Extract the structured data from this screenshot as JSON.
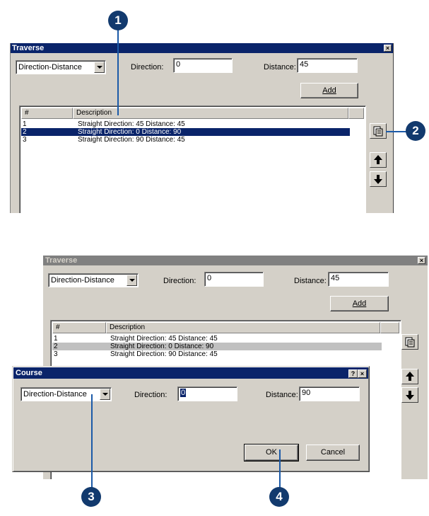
{
  "window1": {
    "title": "Traverse",
    "mode": "Direction-Distance",
    "direction_label": "Direction:",
    "direction_value": "0",
    "distance_label": "Distance:",
    "distance_value": "45",
    "add_label": "Add",
    "columns": [
      "#",
      "Description"
    ],
    "rows": [
      {
        "num": "1",
        "desc": "Straight  Direction: 45  Distance: 45"
      },
      {
        "num": "2",
        "desc": "Straight  Direction: 0  Distance: 90"
      },
      {
        "num": "3",
        "desc": "Straight  Direction: 90  Distance: 45"
      }
    ]
  },
  "window2": {
    "title": "Traverse",
    "mode": "Direction-Distance",
    "direction_label": "Direction:",
    "direction_value": "0",
    "distance_label": "Distance:",
    "distance_value": "45",
    "add_label": "Add",
    "columns": [
      "#",
      "Description"
    ],
    "rows": [
      {
        "num": "1",
        "desc": "Straight  Direction: 45  Distance: 45"
      },
      {
        "num": "2",
        "desc": "Straight  Direction: 0  Distance: 90"
      },
      {
        "num": "3",
        "desc": "Straight  Direction: 90  Distance: 45"
      }
    ]
  },
  "course": {
    "title": "Course",
    "help_label": "?",
    "mode": "Direction-Distance",
    "direction_label": "Direction:",
    "direction_value": "0",
    "distance_label": "Distance:",
    "distance_value": "90",
    "ok_label": "OK",
    "cancel_label": "Cancel"
  },
  "callouts": [
    "1",
    "2",
    "3",
    "4"
  ],
  "icons": {
    "properties": "properties-icon",
    "up": "arrow-up-icon",
    "down": "arrow-down-icon",
    "close": "close-icon"
  },
  "colors": {
    "active_title": "#0a246a",
    "inactive_title": "#808080",
    "selection": "#0a246a",
    "callout": "#123a6e",
    "leader": "#1b5aa8"
  }
}
